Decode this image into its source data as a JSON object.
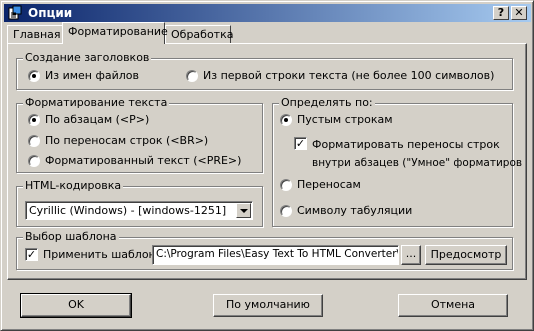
{
  "window": {
    "title": "Опции",
    "help_label": "?",
    "close_label": "✕"
  },
  "tabs": [
    {
      "label": "Главная",
      "active": false
    },
    {
      "label": "Форматирование",
      "active": true
    },
    {
      "label": "Обработка",
      "active": false
    }
  ],
  "headings": {
    "legend": "Создание заголовков",
    "options": [
      {
        "label": "Из имен файлов",
        "selected": true
      },
      {
        "label": "Из первой строки текста (не более 100 символов)",
        "selected": false
      }
    ]
  },
  "text_format": {
    "legend": "Форматирование текста",
    "options": [
      {
        "label": "По абзацам (<P>)",
        "selected": true
      },
      {
        "label": "По переносам строк (<BR>)",
        "selected": false
      },
      {
        "label": "Форматированный текст (<PRE>)",
        "selected": false
      }
    ]
  },
  "detect_by": {
    "legend": "Определять по:",
    "empty_lines": {
      "label": "Пустым строкам",
      "selected": true
    },
    "smart_format": {
      "line1": "Форматировать переносы строк",
      "line2": "внутри абзацев (\"Умное\" форматиров",
      "checked": true
    },
    "line_breaks": {
      "label": "Переносам",
      "selected": false
    },
    "tab_char": {
      "label": "Символу табуляции",
      "selected": false
    }
  },
  "encoding": {
    "legend": "HTML-кодировка",
    "selected": "Cyrillic (Windows) - [windows-1251]"
  },
  "template": {
    "legend": "Выбор шаблона",
    "apply_label": "Применить шаблон:",
    "apply_checked": true,
    "path": "C:\\Program Files\\Easy Text To HTML Converter\\T",
    "browse_label": "...",
    "preview_label": "Предосмотр"
  },
  "buttons": {
    "ok": "OK",
    "defaults": "По умолчанию",
    "cancel": "Отмена"
  },
  "colors": {
    "face": "#d4d0c8",
    "titlebar_start": "#0a246a",
    "titlebar_end": "#a6caf0"
  }
}
